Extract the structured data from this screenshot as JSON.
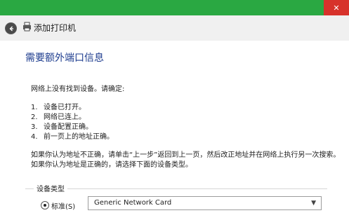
{
  "window": {
    "close_label": "✕"
  },
  "header": {
    "title": "添加打印机"
  },
  "content": {
    "heading": "需要额外端口信息",
    "intro": "网络上没有找到设备。请确定:",
    "list": [
      {
        "num": "1.",
        "text": "设备已打开。"
      },
      {
        "num": "2.",
        "text": "网络已连上。"
      },
      {
        "num": "3.",
        "text": "设备配置正确。"
      },
      {
        "num": "4.",
        "text": "前一页上的地址正确。"
      }
    ],
    "advice_1": "如果你认为地址不正确，请单击“上一步”返回到上一页，然后改正地址并在网络上执行另一次搜索。",
    "advice_2": "如果你认为地址是正确的，请选择下面的设备类型。"
  },
  "device_type": {
    "label": "设备类型",
    "radio_label": "标准(S)",
    "selected": "Generic Network Card"
  }
}
